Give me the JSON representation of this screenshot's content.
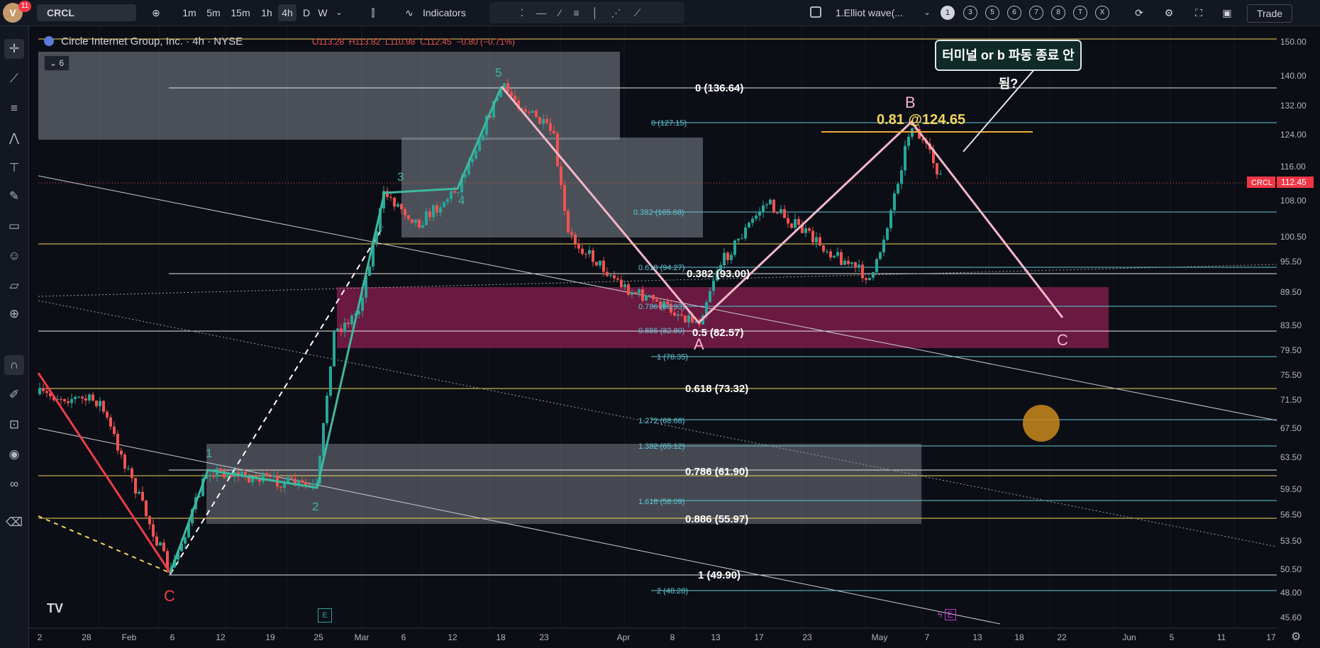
{
  "toolbar": {
    "avatar_letter": "V",
    "notification_count": "11",
    "symbol": "CRCL",
    "timeframes": [
      "1m",
      "5m",
      "15m",
      "1h",
      "4h",
      "D",
      "W"
    ],
    "active_timeframe": "4h",
    "indicators_label": "Indicators",
    "layout_name": "1.Elliot wave(...",
    "layout_slots": [
      "1",
      "3",
      "5",
      "6",
      "7",
      "8",
      "T",
      "X"
    ],
    "trade_label": "Trade"
  },
  "legend": {
    "title": "Circle Internet Group, Inc. · 4h · NYSE",
    "open": "O113.28",
    "high": "H113.82",
    "low": "L110.98",
    "close": "C112.45",
    "change": "−0.80 (−0.71%)",
    "collapsed_count": "6"
  },
  "price_tag": {
    "symbol": "CRCL",
    "price": "112.45"
  },
  "callout_text": "터미널 or b 파동 종료 안됨?",
  "price_axis": [
    "150.00",
    "140.00",
    "132.00",
    "124.00",
    "116.00",
    "108.00",
    "100.50",
    "95.50",
    "89.50",
    "83.50",
    "79.50",
    "75.50",
    "71.50",
    "67.50",
    "63.50",
    "59.50",
    "56.50",
    "53.50",
    "50.50",
    "48.00",
    "45.60"
  ],
  "time_axis": [
    "2",
    "28",
    "Feb",
    "6",
    "12",
    "19",
    "25",
    "Mar",
    "6",
    "12",
    "18",
    "23",
    "Apr",
    "8",
    "13",
    "17",
    "23",
    "May",
    "7",
    "13",
    "18",
    "22",
    "Jun",
    "5",
    "11",
    "17"
  ],
  "fib_major": [
    {
      "label": "0 (136.64)"
    },
    {
      "label": "0.382 (93.00)"
    },
    {
      "label": "0.5 (82.57)"
    },
    {
      "label": "0.618 (73.32)"
    },
    {
      "label": "0.786 (61.90)"
    },
    {
      "label": "0.886 (55.97)"
    },
    {
      "label": "1 (49.90)"
    }
  ],
  "fib_minor": [
    {
      "label": "0 (127.15)"
    },
    {
      "label": "0.382 (105.68)"
    },
    {
      "label": "0.618 (94.27)"
    },
    {
      "label": "0.786 (86.93)"
    },
    {
      "label": "0.886 (82.80)"
    },
    {
      "label": "1 (78.35)"
    },
    {
      "label": "1.272 (68.68)"
    },
    {
      "label": "1.382 (65.12)"
    },
    {
      "label": "1.618 (58.09)"
    },
    {
      "label": "2 (48.28)"
    }
  ],
  "wave_labels": {
    "w1": "1",
    "w2": "2",
    "w3": "3",
    "w4": "4",
    "w5": "5",
    "A": "A",
    "B": "B",
    "C_left": "C",
    "C_right": "C"
  },
  "b_annotation": "0.81 @124.65",
  "colors": {
    "up": "#26a69a",
    "down": "#ef5350",
    "wave_green": "#3fb89f",
    "abc_pink": "#f4b6c8",
    "fib_cyan": "#5fc8d8",
    "fib_yellow": "#f2d45c"
  }
}
